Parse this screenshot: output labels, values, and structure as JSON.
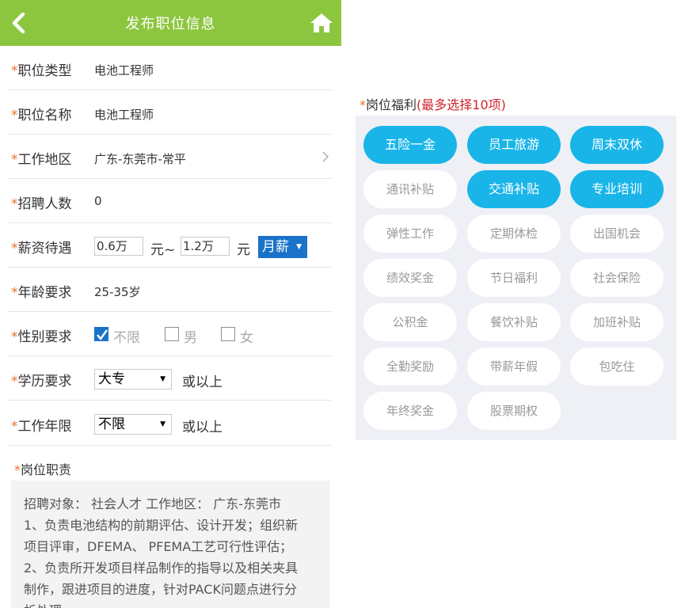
{
  "header": {
    "title": "发布职位信息",
    "back_icon": "chevron-left-icon",
    "home_icon": "home-icon"
  },
  "form": {
    "job_type": {
      "label": "职位类型",
      "value": "电池工程师"
    },
    "job_name": {
      "label": "职位名称",
      "value": "电池工程师"
    },
    "work_area": {
      "label": "工作地区",
      "value": "广东-东莞市-常平"
    },
    "headcount": {
      "label": "招聘人数",
      "value": "0"
    },
    "salary": {
      "label": "薪资待遇",
      "min": "0.6万",
      "sep": "元~",
      "max": "1.2万",
      "unit": "元",
      "period": "月薪"
    },
    "age": {
      "label": "年龄要求",
      "value": "25-35岁"
    },
    "gender": {
      "label": "性别要求",
      "options": [
        "不限",
        "男",
        "女"
      ],
      "checked": [
        true,
        false,
        false
      ]
    },
    "education": {
      "label": "学历要求",
      "value": "大专",
      "suffix": "或以上"
    },
    "experience": {
      "label": "工作年限",
      "value": "不限",
      "suffix": "或以上"
    },
    "required_mark": "*",
    "dropdown_marker": "▼"
  },
  "duties": {
    "label": "岗位职责",
    "lines": [
      "招聘对象： 社会人才 工作地区： 广东-东莞市",
      "1、负责电池结构的前期评估、设计开发；组织新",
      "项目评审，DFEMA、 PFEMA工艺可行性评估；",
      "2、负责所开发项目样品制作的指导以及相关夹具",
      "制作，跟进项目的进度，针对PACK问题点进行分",
      "析处理"
    ]
  },
  "benefits": {
    "label": "岗位福利",
    "hint": "(最多选择10项)",
    "items": [
      {
        "label": "五险一金",
        "selected": true
      },
      {
        "label": "员工旅游",
        "selected": true
      },
      {
        "label": "周末双休",
        "selected": true
      },
      {
        "label": "通讯补贴",
        "selected": false
      },
      {
        "label": "交通补贴",
        "selected": true
      },
      {
        "label": "专业培训",
        "selected": true
      },
      {
        "label": "弹性工作",
        "selected": false
      },
      {
        "label": "定期体检",
        "selected": false
      },
      {
        "label": "出国机会",
        "selected": false
      },
      {
        "label": "绩效奖金",
        "selected": false
      },
      {
        "label": "节日福利",
        "selected": false
      },
      {
        "label": "社会保险",
        "selected": false
      },
      {
        "label": "公积金",
        "selected": false
      },
      {
        "label": "餐饮补贴",
        "selected": false
      },
      {
        "label": "加班补贴",
        "selected": false
      },
      {
        "label": "全勤奖励",
        "selected": false
      },
      {
        "label": "带薪年假",
        "selected": false
      },
      {
        "label": "包吃住",
        "selected": false
      },
      {
        "label": "年终奖金",
        "selected": false
      },
      {
        "label": "股票期权",
        "selected": false
      }
    ]
  },
  "colors": {
    "header_green": "#8cc63f",
    "accent_blue": "#19b5e8",
    "select_blue": "#1a73c9",
    "required_orange": "#e8732a",
    "hint_red": "#d0232d"
  }
}
